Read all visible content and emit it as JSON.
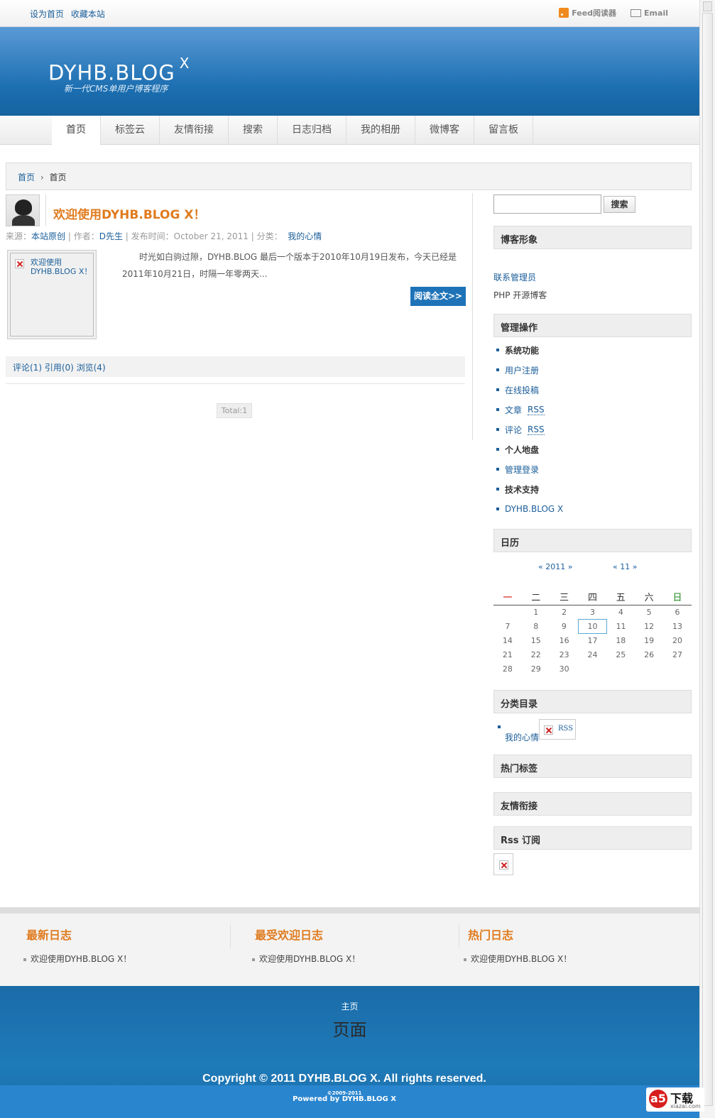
{
  "topbar": {
    "set_home": "设为首页",
    "bookmark": "收藏本站",
    "feed": "Feed阅读器",
    "email": "Email"
  },
  "header": {
    "logo": "DYHB.BLOG",
    "logo_suffix": "X",
    "tagline": "新一代CMS单用户博客程序"
  },
  "nav": {
    "items": [
      "首页",
      "标签云",
      "友情衔接",
      "搜索",
      "日志归档",
      "我的相册",
      "微博客",
      "留言板"
    ]
  },
  "breadcrumb": {
    "home": "首页",
    "sep": "›",
    "current": "首页"
  },
  "post": {
    "title": "欢迎使用DYHB.BLOG X！",
    "meta_source_label": "来源：",
    "meta_source": "本站原创",
    "meta_author_label": "| 作者：",
    "meta_author": "D先生",
    "meta_date_label": "| 发布时间：",
    "meta_date": "October 21, 2011",
    "meta_cat_label": "| 分类：",
    "meta_cat": "我的心情",
    "thumb_alt": "欢迎使用DYHB.BLOG X！",
    "excerpt": "时光如白驹过隙，DYHB.BLOG 最后一个版本于2010年10月19日发布，今天已经是2011年10月21日，时隔一年零两天...",
    "read_more": "阅读全文>>",
    "stats": "评论(1) 引用(0) 浏览(4)",
    "total": "Total:1"
  },
  "sidebar": {
    "search_button": "搜索",
    "search_value": "",
    "blogger_title": "博客形象",
    "contact": "联系管理员",
    "desc": "PHP 开源博客",
    "admin_title": "管理操作",
    "admin_items": [
      {
        "label": "系统功能",
        "bold": true
      },
      {
        "label": "用户注册",
        "bold": false
      },
      {
        "label": "在线投稿",
        "bold": false
      },
      {
        "label": "文章",
        "rss": "RSS",
        "bold": false
      },
      {
        "label": "评论",
        "rss": "RSS",
        "bold": false
      },
      {
        "label": "个人地盘",
        "bold": true
      },
      {
        "label": "管理登录",
        "bold": false
      },
      {
        "label": "技术支持",
        "bold": true
      },
      {
        "label": "DYHB.BLOG X",
        "bold": false
      }
    ],
    "calendar_title": "日历",
    "cal_prev": "« 2011 »",
    "cal_next": "« 11 »",
    "weekdays": [
      "一",
      "二",
      "三",
      "四",
      "五",
      "六",
      "日"
    ],
    "weeks": [
      [
        "",
        "1",
        "2",
        "3",
        "4",
        "5",
        "6"
      ],
      [
        "7",
        "8",
        "9",
        "10",
        "11",
        "12",
        "13"
      ],
      [
        "14",
        "15",
        "16",
        "17",
        "18",
        "19",
        "20"
      ],
      [
        "21",
        "22",
        "23",
        "24",
        "25",
        "26",
        "27"
      ],
      [
        "28",
        "29",
        "30",
        "",
        "",
        "",
        ""
      ]
    ],
    "today": "10",
    "category_title": "分类目录",
    "category_item": "我的心情",
    "category_rss": "RSS",
    "hot_tags_title": "热门标签",
    "links_title": "友情衔接",
    "rss_title": "Rss 订阅"
  },
  "footer": {
    "col1_title": "最新日志",
    "col1_item": "欢迎使用DYHB.BLOG X！",
    "col2_title": "最受欢迎日志",
    "col2_item": "欢迎使用DYHB.BLOG X！",
    "col3_title": "热门日志",
    "col3_item": "欢迎使用DYHB.BLOG X！",
    "home": "主页",
    "page": "页面",
    "copyright": "Copyright © 2011 DYHB.BLOG X. All rights reserved.",
    "powered": "Powered by DYHB.BLOG X",
    "powered_years": "©2009-2011"
  },
  "watermark": {
    "text": "下载",
    "sub": "xiazai.com",
    "badge": "a5"
  }
}
